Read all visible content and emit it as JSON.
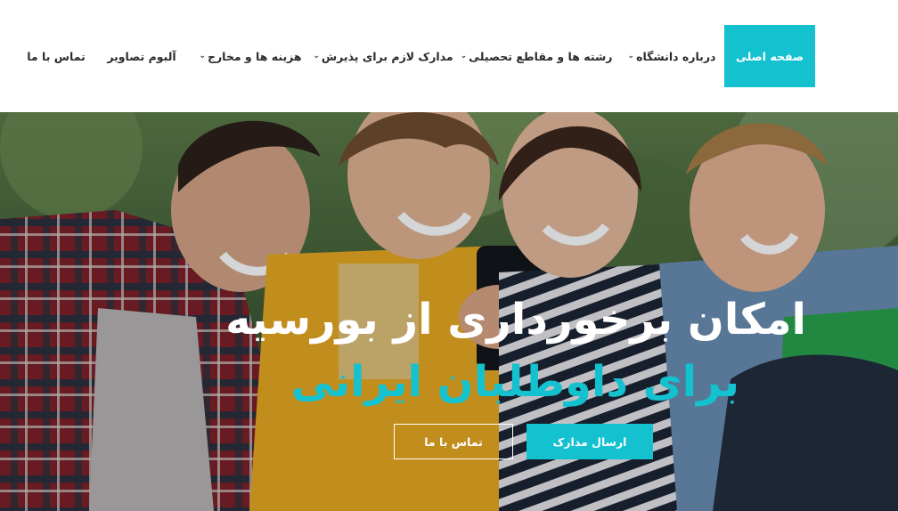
{
  "nav": {
    "items": [
      {
        "label": "صفحه اصلی",
        "active": true,
        "dropdown": false
      },
      {
        "label": "درباره دانشگاه",
        "active": false,
        "dropdown": true
      },
      {
        "label": "رشته ها و مقاطع تحصیلی",
        "active": false,
        "dropdown": true
      },
      {
        "label": "مدارک لازم برای پذیرش",
        "active": false,
        "dropdown": true
      },
      {
        "label": "هزینه ها و مخارج",
        "active": false,
        "dropdown": true
      },
      {
        "label": "آلبوم تصاویر",
        "active": false,
        "dropdown": false
      },
      {
        "label": "تماس با ما",
        "active": false,
        "dropdown": false
      }
    ],
    "dropdown_icon": "chevron-down-icon"
  },
  "hero": {
    "headline_line1": "امکان برخورداری از بورسیه",
    "headline_line2": "برای داوطلبان ایرانی",
    "primary_button": "ارسال مدارک",
    "secondary_button": "تماس با ما",
    "image": "group of four students laughing while looking at a phone"
  },
  "colors": {
    "accent": "#14c1cf",
    "text_dark": "#2b2b2b",
    "white": "#ffffff"
  }
}
